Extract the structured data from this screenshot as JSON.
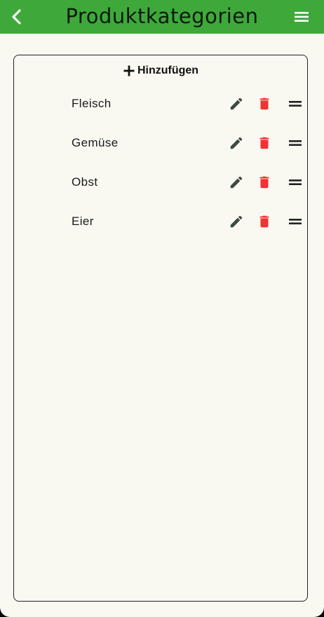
{
  "appbar": {
    "title": "Produktkategorien",
    "back_icon": "chevron-left-icon",
    "menu_icon": "hamburger-menu-icon",
    "background_color": "#3ea93a"
  },
  "add_button": {
    "icon": "plus-icon",
    "label": "Hinzufügen"
  },
  "categories": [
    {
      "label": "Fleisch"
    },
    {
      "label": "Gemüse"
    },
    {
      "label": "Obst"
    },
    {
      "label": "Eier"
    }
  ],
  "row_icons": {
    "edit": "pencil-icon",
    "delete": "trash-icon",
    "drag": "drag-handle-icon"
  },
  "colors": {
    "delete_red": "#f03333",
    "edit_gray": "#3d4a40",
    "background": "#f9f9f2"
  }
}
